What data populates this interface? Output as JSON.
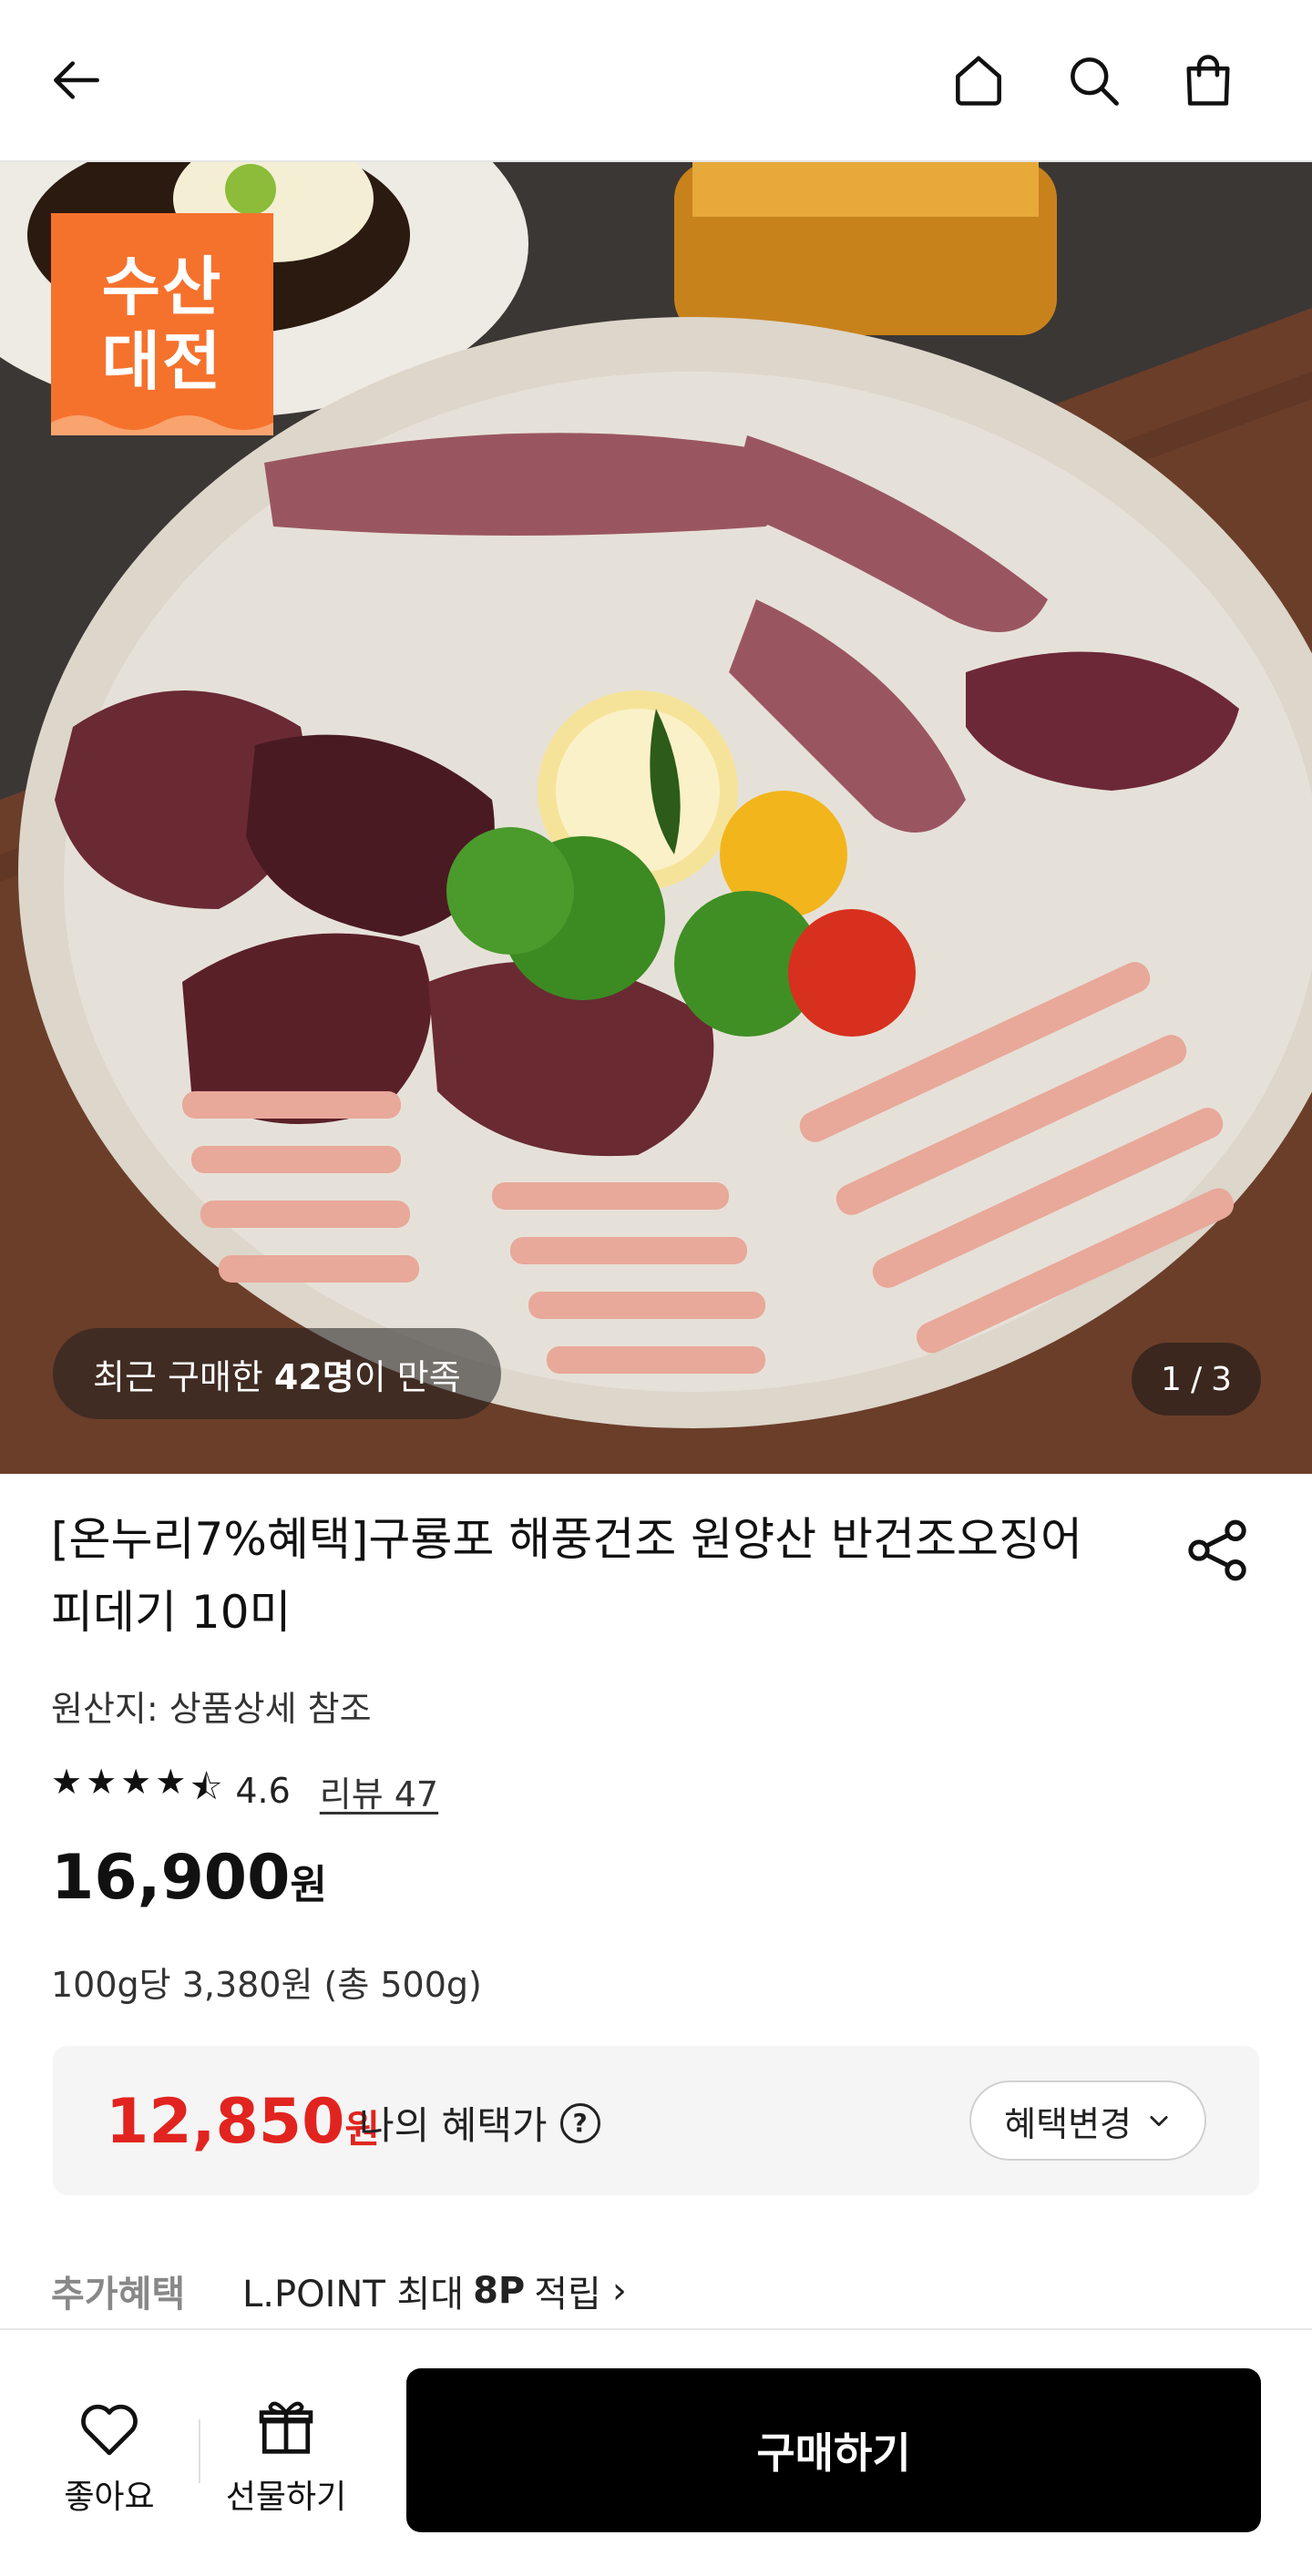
{
  "header": {
    "back_icon": "arrow-left-icon",
    "home_icon": "home-icon",
    "search_icon": "search-icon",
    "cart_icon": "shopping-bag-icon"
  },
  "hero": {
    "badge_line1": "수산",
    "badge_line2": "대전",
    "badge_color": "#f5722d",
    "satisfaction_prefix": "최근 구매한",
    "satisfaction_count": "42명",
    "satisfaction_suffix": "이 만족",
    "page_current": "1",
    "page_sep": "/",
    "page_total": "3"
  },
  "product": {
    "title": "[온누리7%혜택]구룡포 해풍건조 원양산 반건조오징어 피데기 10미",
    "origin": "원산지: 상품상세 참조",
    "rating": "4.6",
    "stars": [
      "★",
      "★",
      "★",
      "★",
      "⯪"
    ],
    "review": "리뷰 47",
    "price": "16,900",
    "price_unit": "원",
    "unit_price": "100g당 3,380원 (총 500g)"
  },
  "benefit": {
    "price": "12,850",
    "price_unit": "원",
    "label": "나의 혜택가",
    "help": "?",
    "change_button": "혜택변경",
    "change_chevron": "⌄",
    "accent_color": "#e1241f"
  },
  "extra": {
    "label": "추가혜택",
    "text_prefix": "L.POINT 최대",
    "points": "8P",
    "text_suffix": "적립",
    "chevron": "›"
  },
  "bottom": {
    "like_label": "좋아요",
    "gift_label": "선물하기",
    "buy_label": "구매하기"
  }
}
